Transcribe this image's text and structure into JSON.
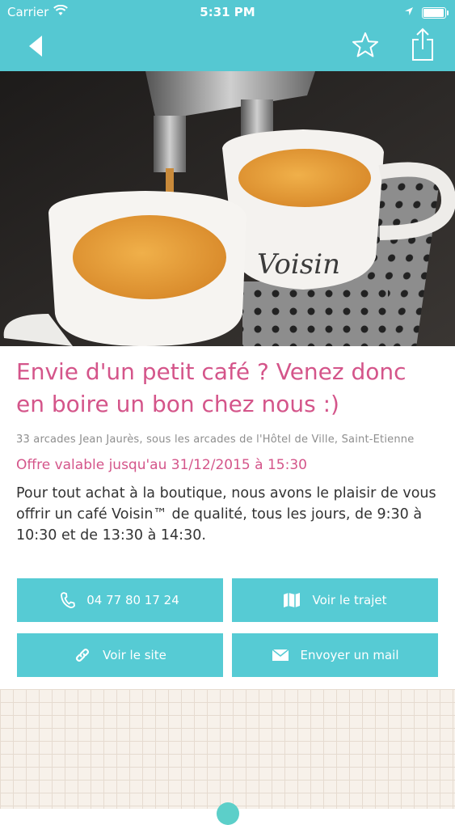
{
  "status_bar": {
    "carrier": "Carrier",
    "time": "5:31 PM"
  },
  "nav": {
    "back_icon": "back-arrow-icon",
    "favorite_icon": "star-outline-icon",
    "share_icon": "share-icon",
    "bar_color": "#55c8d2"
  },
  "hero": {
    "image": "two espresso cups under a coffee machine",
    "cup_brand": "Voisin"
  },
  "offer": {
    "title": "Envie d'un petit café ? Venez donc en boire un bon chez nous :)",
    "address": "33 arcades Jean Jaurès, sous les arcades de l'Hôtel de Ville, Saint-Etienne",
    "validity": "Offre valable jusqu'au 31/12/2015 à 15:30",
    "description": "Pour tout achat à la boutique, nous avons le plaisir de vous offrir un café Voisin™ de qualité, tous les jours, de 9:30 à 10:30 et de 13:30 à 14:30."
  },
  "actions": {
    "phone": {
      "label": "04 77 80 17 24",
      "icon": "phone-icon"
    },
    "route": {
      "label": "Voir le trajet",
      "icon": "map-icon"
    },
    "site": {
      "label": "Voir le site",
      "icon": "link-icon"
    },
    "mail": {
      "label": "Envoyer un mail",
      "icon": "envelope-icon"
    }
  },
  "colors": {
    "accent": "#d4558a",
    "button": "#56cbd4",
    "text": "#333333",
    "muted": "#8e8e8e"
  }
}
